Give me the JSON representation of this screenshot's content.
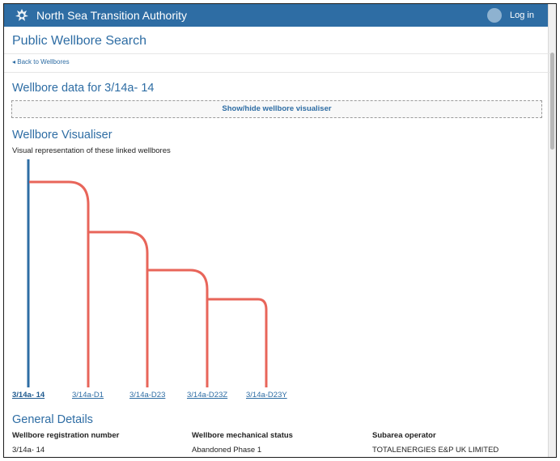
{
  "header": {
    "title": "North Sea Transition Authority",
    "login_label": "Log in"
  },
  "page": {
    "title": "Public Wellbore Search",
    "back_link": "◂ Back to Wellbores",
    "wellbore_heading": "Wellbore data for 3/14a- 14",
    "visualiser_toggle": "Show/hide wellbore visualiser",
    "visualiser_heading": "Wellbore Visualiser",
    "visualiser_caption": "Visual representation of these linked wellbores"
  },
  "visualiser": {
    "main_color": "#2e6da4",
    "branch_color": "#e8655a",
    "wellbores": [
      {
        "label": "3/14a- 14",
        "type": "main"
      },
      {
        "label": "3/14a-D1",
        "type": "branch"
      },
      {
        "label": "3/14a-D23",
        "type": "branch"
      },
      {
        "label": "3/14a-D23Z",
        "type": "branch"
      },
      {
        "label": "3/14a-D23Y",
        "type": "branch"
      }
    ]
  },
  "general": {
    "heading": "General Details",
    "fields": [
      {
        "label": "Wellbore registration number",
        "value": "3/14a- 14"
      },
      {
        "label": "Wellbore mechanical status",
        "value": "Abandoned Phase 1"
      },
      {
        "label": "Subarea operator",
        "value": "TOTALENERGIES E&P UK LIMITED"
      }
    ]
  }
}
